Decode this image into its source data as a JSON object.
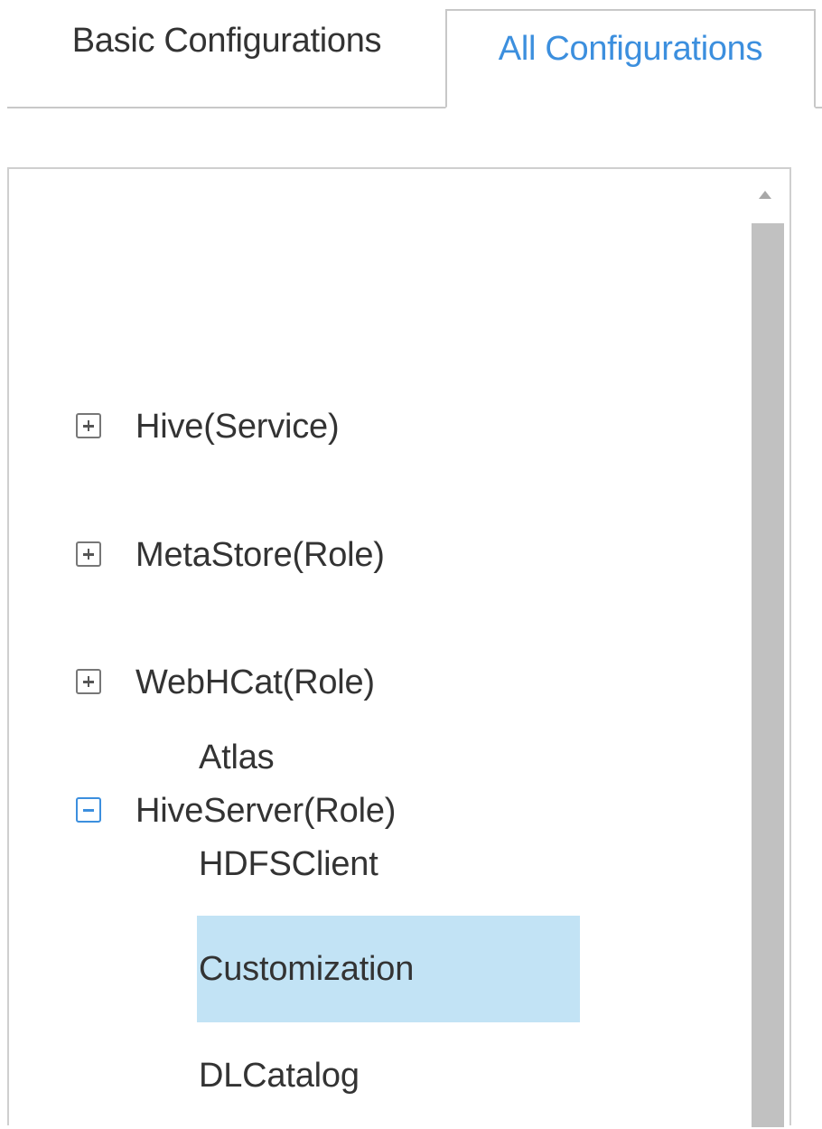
{
  "tabs": {
    "basic_label": "Basic Configurations",
    "all_label": "All Configurations",
    "active": "All Configurations"
  },
  "tree": {
    "nodes": [
      {
        "label": "Hive(Service)",
        "state": "collapsed"
      },
      {
        "label": "MetaStore(Role)",
        "state": "collapsed"
      },
      {
        "label": "WebHCat(Role)",
        "state": "collapsed"
      },
      {
        "label": "HiveServer(Role)",
        "state": "expanded"
      }
    ],
    "children": [
      {
        "label": "Atlas"
      },
      {
        "label": "HDFSClient"
      },
      {
        "label": "Customization",
        "selected": true
      },
      {
        "label": "DLCatalog"
      }
    ]
  },
  "colors": {
    "accent": "#3c8fde",
    "selection": "#c2e3f5",
    "border": "#c8c8c8",
    "scroll_thumb": "#c1c1c1"
  },
  "icons": {
    "collapsed": "plus-square-icon",
    "expanded": "minus-square-icon",
    "scroll_up": "triangle-up-icon"
  }
}
